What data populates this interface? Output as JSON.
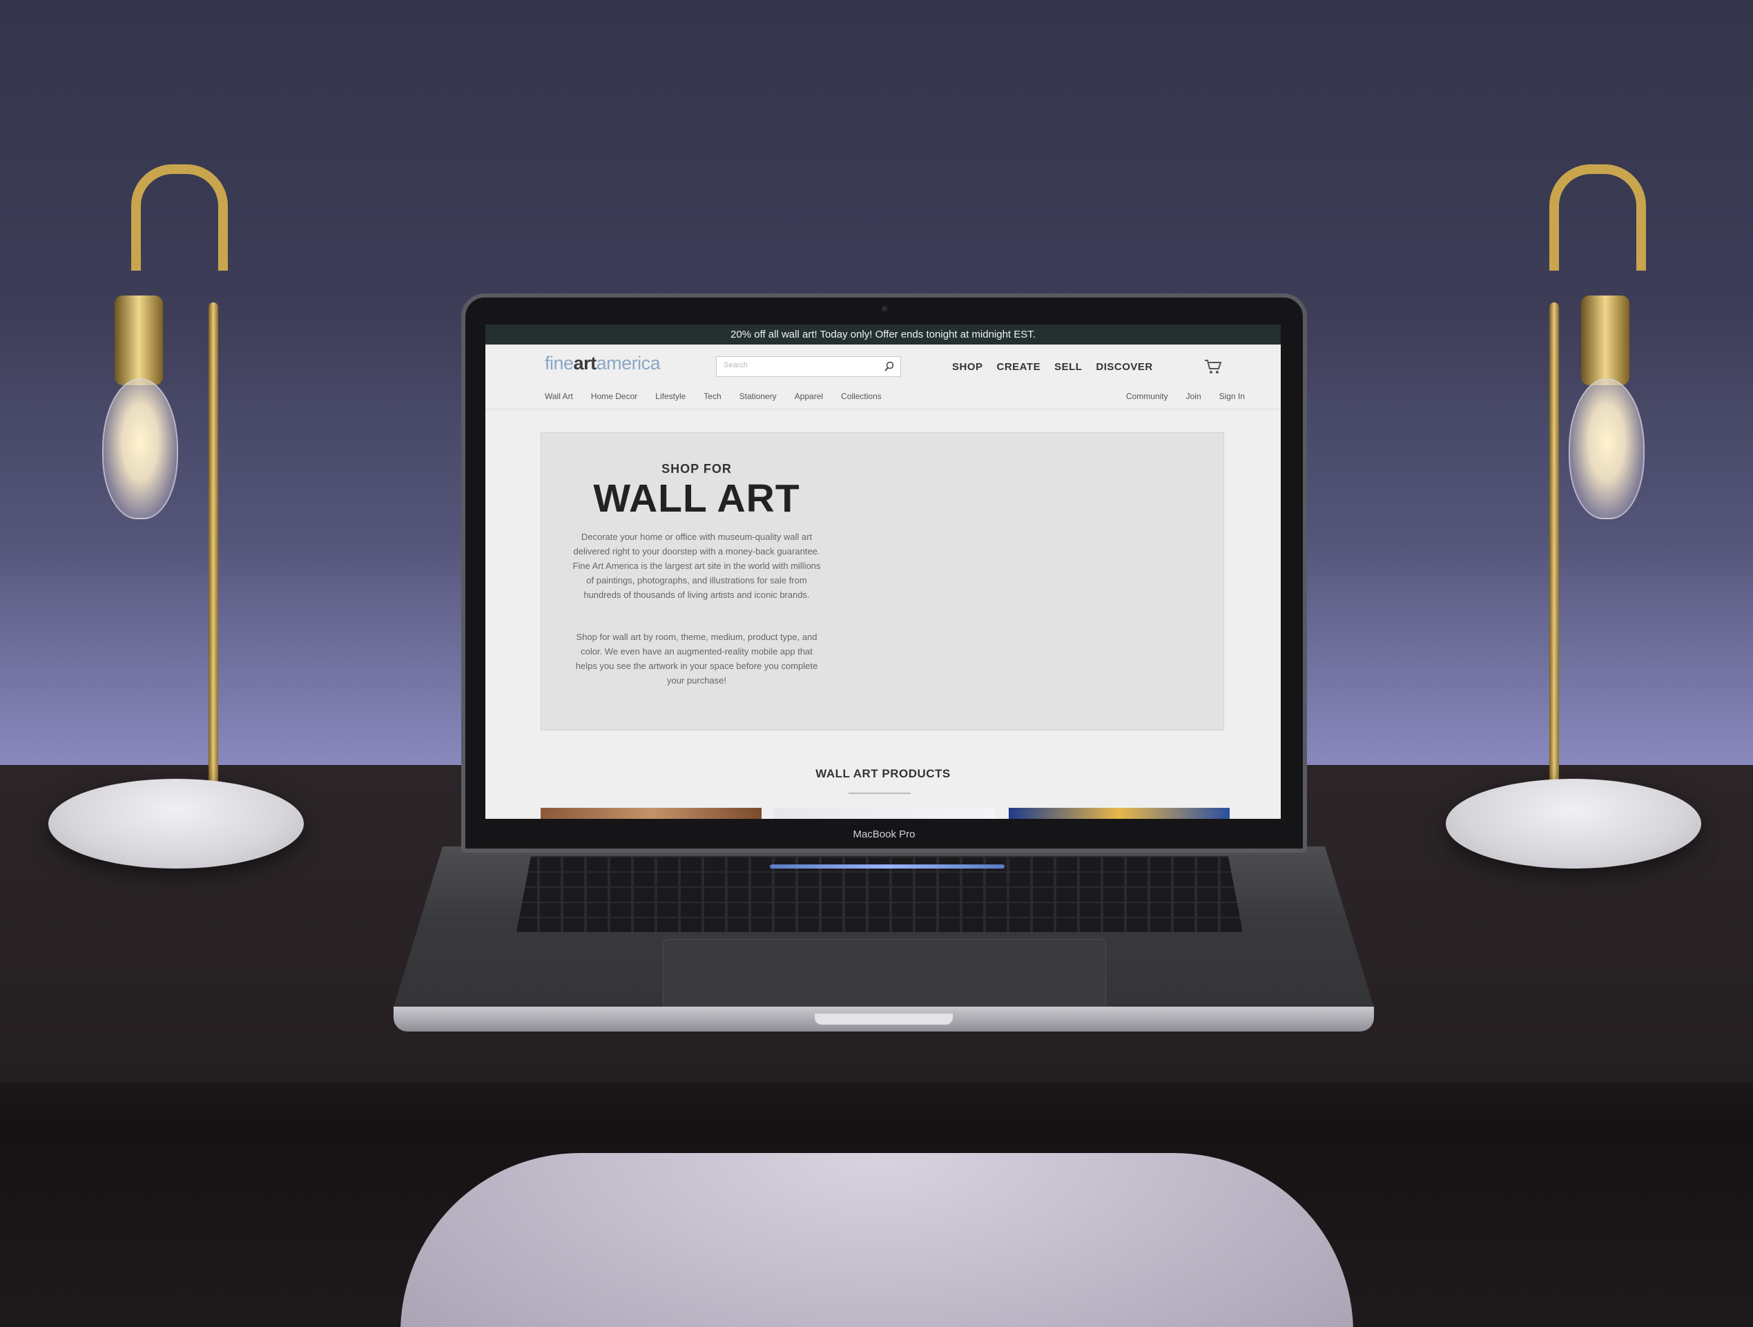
{
  "site": {
    "promo": "20% off all wall art!   Today only!   Offer ends tonight at midnight EST.",
    "logo": {
      "part1": "fine",
      "part2": "art",
      "part3": "america"
    },
    "search": {
      "placeholder": "Search"
    },
    "top_nav": [
      "SHOP",
      "CREATE",
      "SELL",
      "DISCOVER"
    ],
    "sub_nav_left": [
      "Wall Art",
      "Home Decor",
      "Lifestyle",
      "Tech",
      "Stationery",
      "Apparel",
      "Collections"
    ],
    "sub_nav_right": [
      "Community",
      "Join",
      "Sign In"
    ],
    "hero": {
      "kicker": "SHOP FOR",
      "title": "WALL ART",
      "paragraph1": "Decorate your home or office with museum-quality wall art delivered right to your doorstep with a money-back guarantee.   Fine Art America is the largest art site in the world with millions of paintings, photographs, and illustrations for sale from hundreds of thousands of living artists and iconic brands.",
      "paragraph2": "Shop for wall art by room, theme, medium, product type, and color.   We even have an augmented-reality mobile app that helps you see the artwork in your space before you complete your purchase!"
    },
    "products_heading": "WALL ART PRODUCTS"
  },
  "laptop": {
    "label": "MacBook Pro"
  },
  "colors": {
    "promo_bg": "#23302f",
    "logo_accent": "#8aa7c7",
    "wall": "#3d3d58",
    "desk": "#2a2426",
    "brass": "#c9a54e"
  },
  "icons": [
    "search-icon",
    "cart-icon",
    "lamp-icon"
  ]
}
